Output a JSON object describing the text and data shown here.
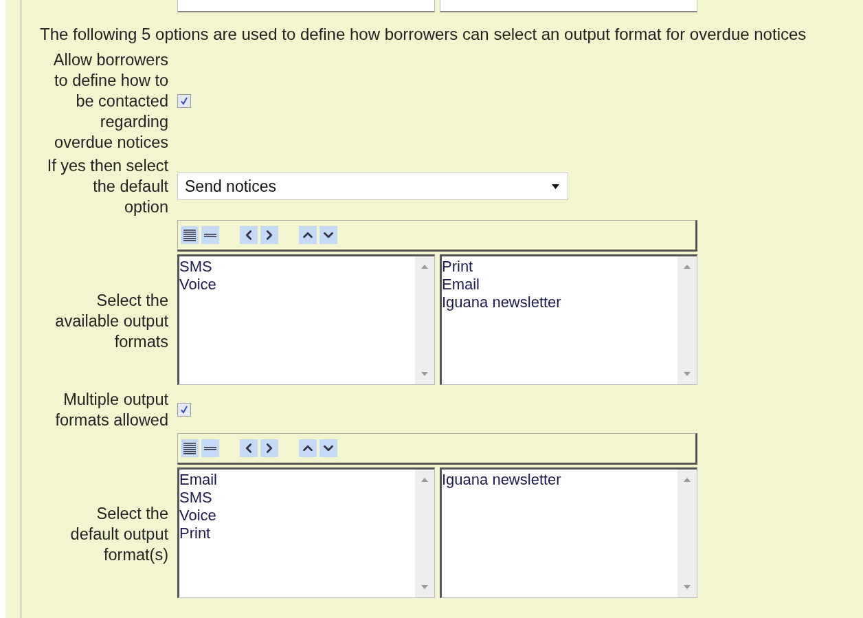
{
  "intro": "The following 5 options are used to define how borrowers can select an output format for overdue notices",
  "settings": [
    {
      "kind": "checkbox",
      "label": "Allow borrowers to define how to be contacted regarding overdue notices",
      "checked": true
    },
    {
      "kind": "select",
      "label": "If yes then select the default option",
      "value": "Send notices"
    },
    {
      "kind": "dual_list",
      "label": "Select the available output formats",
      "available": [
        "SMS",
        "Voice"
      ],
      "chosen": [
        "Print",
        "Email",
        "Iguana newsletter"
      ]
    },
    {
      "kind": "checkbox",
      "label": "Multiple output formats allowed",
      "checked": true
    },
    {
      "kind": "dual_list",
      "label": "Select the default output format(s)",
      "available": [
        "Email",
        "SMS",
        "Voice",
        "Print"
      ],
      "chosen": [
        "Iguana newsletter"
      ]
    }
  ]
}
